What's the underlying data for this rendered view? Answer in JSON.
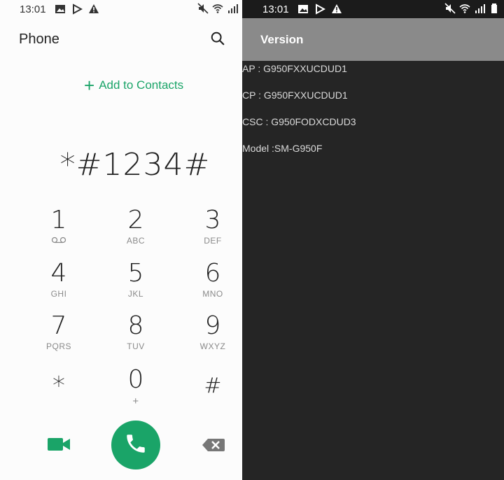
{
  "left_status": {
    "time": "13:01"
  },
  "right_status": {
    "time": "13:01"
  },
  "phone": {
    "title": "Phone",
    "add_to_contacts": "Add to Contacts",
    "dialed_number": "*#1234#",
    "keys": [
      {
        "num": "1",
        "sub": ""
      },
      {
        "num": "2",
        "sub": "ABC"
      },
      {
        "num": "3",
        "sub": "DEF"
      },
      {
        "num": "4",
        "sub": "GHI"
      },
      {
        "num": "5",
        "sub": "JKL"
      },
      {
        "num": "6",
        "sub": "MNO"
      },
      {
        "num": "7",
        "sub": "PQRS"
      },
      {
        "num": "8",
        "sub": "TUV"
      },
      {
        "num": "9",
        "sub": "WXYZ"
      },
      {
        "num": "*",
        "sub": ""
      },
      {
        "num": "0",
        "sub": "+"
      },
      {
        "num": "#",
        "sub": ""
      }
    ]
  },
  "version_screen": {
    "title": "Version",
    "rows": [
      "AP : G950FXXUCDUD1",
      "CP : G950FXXUCDUD1",
      "CSC : G950FODXCDUD3",
      "Model :SM-G950F"
    ]
  },
  "colors": {
    "accent_green": "#1aa468",
    "toolbar_gray": "#8a8a8a",
    "dark_bg": "#252525"
  },
  "icons": {
    "search": "search-icon",
    "voicemail": "voicemail-icon",
    "video_call": "video-call-icon",
    "call": "phone-call-icon",
    "backspace": "backspace-icon"
  }
}
